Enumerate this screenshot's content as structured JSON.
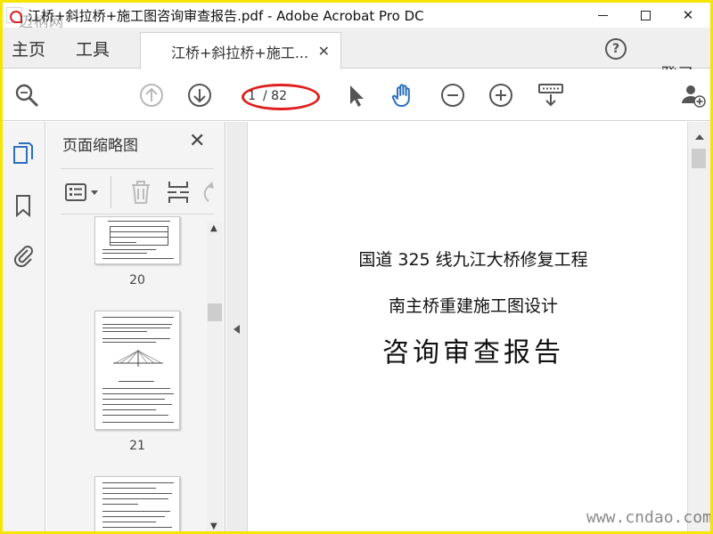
{
  "window": {
    "title": "江桥+斜拉桥+施工图咨询审查报告.pdf - Adobe Acrobat Pro DC",
    "watermark_top": "迈柄网",
    "minimize_label": "",
    "maximize_label": "",
    "close_label": "✕"
  },
  "menubar": {
    "home": "主页",
    "tools": "工具",
    "tab_label": "江桥+斜拉桥+施工...",
    "tab_close": "✕",
    "help": "?",
    "login": "登录"
  },
  "toolbar": {
    "page_current": "1",
    "page_total": "/ 82"
  },
  "thumbnails": {
    "title": "页面缩略图",
    "close": "✕",
    "pages": [
      {
        "label": "20"
      },
      {
        "label": "21"
      },
      {
        "label": ""
      }
    ]
  },
  "document": {
    "line1": "国道 325 线九江大桥修复工程",
    "line2": "南主桥重建施工图设计",
    "line3": "咨询审查报告"
  },
  "watermark_bottom": "www.cndao.com",
  "colors": {
    "accent": "#2c6fbd",
    "annotation_red": "#e02020",
    "frame_yellow": "#f6e500"
  }
}
